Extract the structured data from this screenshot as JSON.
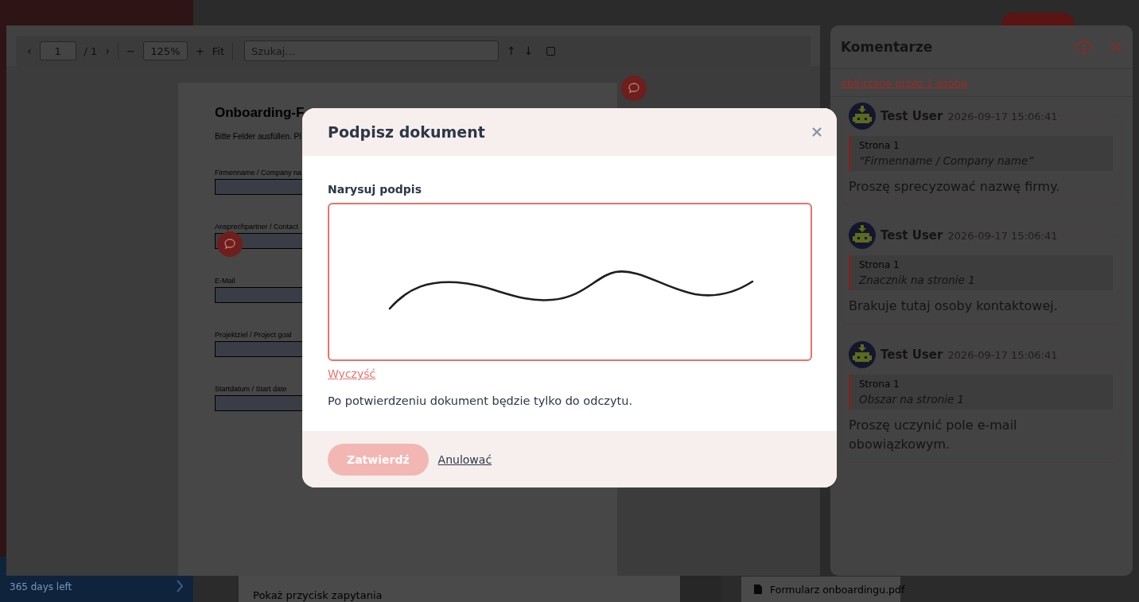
{
  "app": {
    "sidebar_footer": "365 days left",
    "option_label": "Pokaż przycisk zapytania",
    "attachment": "Formularz onboardingu.pdf"
  },
  "pdf_viewer": {
    "toolbar": {
      "prev": "‹",
      "page": "1",
      "page_total": "/ 1",
      "next": "›",
      "zoom_out": "−",
      "zoom": "125%",
      "zoom_in": "+",
      "fit": "Fit",
      "search_placeholder": "Szukaj...",
      "search_prev": "↑",
      "search_next": "↓",
      "highlight_all_checked": false
    },
    "document": {
      "title": "Onboarding-F",
      "intro": "Bitte Felder ausfüllen. Pl",
      "fields": [
        {
          "label": "Firmenname / Company na"
        },
        {
          "label": "Ansprechpartner / Contact"
        },
        {
          "label": "E-Mail"
        },
        {
          "label": "Projektziel / Project goal"
        },
        {
          "label": "Startdatum / Start date"
        }
      ]
    }
  },
  "comments_panel": {
    "title": "Komentarze",
    "seen_by": "obejrzane przez 1 osobę",
    "comments": [
      {
        "author": "Test User",
        "time": "2026-09-17 15:06:41",
        "page": "Strona 1",
        "quote": "“Firmenname / Company name”",
        "text": "Proszę sprecyzować nazwę firmy."
      },
      {
        "author": "Test User",
        "time": "2026-09-17 15:06:41",
        "page": "Strona 1",
        "quote": "Znacznik na stronie 1",
        "text": "Brakuje tutaj osoby kontaktowej."
      },
      {
        "author": "Test User",
        "time": "2026-09-17 15:06:41",
        "page": "Strona 1",
        "quote": "Obszar na stronie 1",
        "text": "Proszę uczynić pole e-mail obowiązkowym."
      }
    ]
  },
  "dialog": {
    "title": "Podpisz dokument",
    "canvas_label": "Narysuj podpis",
    "clear_link": "Wyczyść",
    "note": "Po potwierdzeniu dokument będzie tylko do odczytu.",
    "buttons": [
      {
        "label": "Zatwierdź",
        "kind": "primary",
        "disabled": true
      },
      {
        "label": "Anulować",
        "kind": "link",
        "disabled": false
      }
    ]
  }
}
